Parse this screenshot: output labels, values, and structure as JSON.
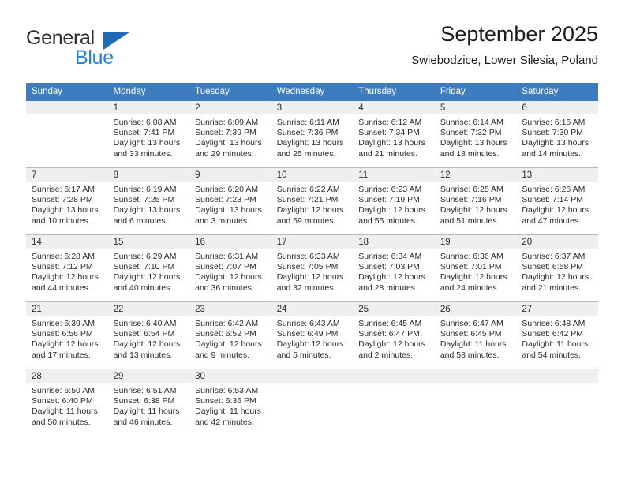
{
  "brand": {
    "name_top": "General",
    "name_bottom": "Blue",
    "accent_dark": "#1f6bb5",
    "accent_light": "#2383d4"
  },
  "header": {
    "title": "September 2025",
    "subtitle": "Swiebodzice, Lower Silesia, Poland"
  },
  "theme": {
    "header_row_bg": "#3d7dbf",
    "daynum_band_bg": "#efefef",
    "grid_line": "#b9b9b9",
    "last_week_line": "#1f5fa8"
  },
  "calendar": {
    "weekday_headers": [
      "Sunday",
      "Monday",
      "Tuesday",
      "Wednesday",
      "Thursday",
      "Friday",
      "Saturday"
    ],
    "weeks": [
      [
        {
          "day": "",
          "empty": true
        },
        {
          "day": "1",
          "sunrise": "Sunrise: 6:08 AM",
          "sunset": "Sunset: 7:41 PM",
          "daylight_1": "Daylight: 13 hours",
          "daylight_2": "and 33 minutes."
        },
        {
          "day": "2",
          "sunrise": "Sunrise: 6:09 AM",
          "sunset": "Sunset: 7:39 PM",
          "daylight_1": "Daylight: 13 hours",
          "daylight_2": "and 29 minutes."
        },
        {
          "day": "3",
          "sunrise": "Sunrise: 6:11 AM",
          "sunset": "Sunset: 7:36 PM",
          "daylight_1": "Daylight: 13 hours",
          "daylight_2": "and 25 minutes."
        },
        {
          "day": "4",
          "sunrise": "Sunrise: 6:12 AM",
          "sunset": "Sunset: 7:34 PM",
          "daylight_1": "Daylight: 13 hours",
          "daylight_2": "and 21 minutes."
        },
        {
          "day": "5",
          "sunrise": "Sunrise: 6:14 AM",
          "sunset": "Sunset: 7:32 PM",
          "daylight_1": "Daylight: 13 hours",
          "daylight_2": "and 18 minutes."
        },
        {
          "day": "6",
          "sunrise": "Sunrise: 6:16 AM",
          "sunset": "Sunset: 7:30 PM",
          "daylight_1": "Daylight: 13 hours",
          "daylight_2": "and 14 minutes."
        }
      ],
      [
        {
          "day": "7",
          "sunrise": "Sunrise: 6:17 AM",
          "sunset": "Sunset: 7:28 PM",
          "daylight_1": "Daylight: 13 hours",
          "daylight_2": "and 10 minutes."
        },
        {
          "day": "8",
          "sunrise": "Sunrise: 6:19 AM",
          "sunset": "Sunset: 7:25 PM",
          "daylight_1": "Daylight: 13 hours",
          "daylight_2": "and 6 minutes."
        },
        {
          "day": "9",
          "sunrise": "Sunrise: 6:20 AM",
          "sunset": "Sunset: 7:23 PM",
          "daylight_1": "Daylight: 13 hours",
          "daylight_2": "and 3 minutes."
        },
        {
          "day": "10",
          "sunrise": "Sunrise: 6:22 AM",
          "sunset": "Sunset: 7:21 PM",
          "daylight_1": "Daylight: 12 hours",
          "daylight_2": "and 59 minutes."
        },
        {
          "day": "11",
          "sunrise": "Sunrise: 6:23 AM",
          "sunset": "Sunset: 7:19 PM",
          "daylight_1": "Daylight: 12 hours",
          "daylight_2": "and 55 minutes."
        },
        {
          "day": "12",
          "sunrise": "Sunrise: 6:25 AM",
          "sunset": "Sunset: 7:16 PM",
          "daylight_1": "Daylight: 12 hours",
          "daylight_2": "and 51 minutes."
        },
        {
          "day": "13",
          "sunrise": "Sunrise: 6:26 AM",
          "sunset": "Sunset: 7:14 PM",
          "daylight_1": "Daylight: 12 hours",
          "daylight_2": "and 47 minutes."
        }
      ],
      [
        {
          "day": "14",
          "sunrise": "Sunrise: 6:28 AM",
          "sunset": "Sunset: 7:12 PM",
          "daylight_1": "Daylight: 12 hours",
          "daylight_2": "and 44 minutes."
        },
        {
          "day": "15",
          "sunrise": "Sunrise: 6:29 AM",
          "sunset": "Sunset: 7:10 PM",
          "daylight_1": "Daylight: 12 hours",
          "daylight_2": "and 40 minutes."
        },
        {
          "day": "16",
          "sunrise": "Sunrise: 6:31 AM",
          "sunset": "Sunset: 7:07 PM",
          "daylight_1": "Daylight: 12 hours",
          "daylight_2": "and 36 minutes."
        },
        {
          "day": "17",
          "sunrise": "Sunrise: 6:33 AM",
          "sunset": "Sunset: 7:05 PM",
          "daylight_1": "Daylight: 12 hours",
          "daylight_2": "and 32 minutes."
        },
        {
          "day": "18",
          "sunrise": "Sunrise: 6:34 AM",
          "sunset": "Sunset: 7:03 PM",
          "daylight_1": "Daylight: 12 hours",
          "daylight_2": "and 28 minutes."
        },
        {
          "day": "19",
          "sunrise": "Sunrise: 6:36 AM",
          "sunset": "Sunset: 7:01 PM",
          "daylight_1": "Daylight: 12 hours",
          "daylight_2": "and 24 minutes."
        },
        {
          "day": "20",
          "sunrise": "Sunrise: 6:37 AM",
          "sunset": "Sunset: 6:58 PM",
          "daylight_1": "Daylight: 12 hours",
          "daylight_2": "and 21 minutes."
        }
      ],
      [
        {
          "day": "21",
          "sunrise": "Sunrise: 6:39 AM",
          "sunset": "Sunset: 6:56 PM",
          "daylight_1": "Daylight: 12 hours",
          "daylight_2": "and 17 minutes."
        },
        {
          "day": "22",
          "sunrise": "Sunrise: 6:40 AM",
          "sunset": "Sunset: 6:54 PM",
          "daylight_1": "Daylight: 12 hours",
          "daylight_2": "and 13 minutes."
        },
        {
          "day": "23",
          "sunrise": "Sunrise: 6:42 AM",
          "sunset": "Sunset: 6:52 PM",
          "daylight_1": "Daylight: 12 hours",
          "daylight_2": "and 9 minutes."
        },
        {
          "day": "24",
          "sunrise": "Sunrise: 6:43 AM",
          "sunset": "Sunset: 6:49 PM",
          "daylight_1": "Daylight: 12 hours",
          "daylight_2": "and 5 minutes."
        },
        {
          "day": "25",
          "sunrise": "Sunrise: 6:45 AM",
          "sunset": "Sunset: 6:47 PM",
          "daylight_1": "Daylight: 12 hours",
          "daylight_2": "and 2 minutes."
        },
        {
          "day": "26",
          "sunrise": "Sunrise: 6:47 AM",
          "sunset": "Sunset: 6:45 PM",
          "daylight_1": "Daylight: 11 hours",
          "daylight_2": "and 58 minutes."
        },
        {
          "day": "27",
          "sunrise": "Sunrise: 6:48 AM",
          "sunset": "Sunset: 6:42 PM",
          "daylight_1": "Daylight: 11 hours",
          "daylight_2": "and 54 minutes."
        }
      ],
      [
        {
          "day": "28",
          "sunrise": "Sunrise: 6:50 AM",
          "sunset": "Sunset: 6:40 PM",
          "daylight_1": "Daylight: 11 hours",
          "daylight_2": "and 50 minutes."
        },
        {
          "day": "29",
          "sunrise": "Sunrise: 6:51 AM",
          "sunset": "Sunset: 6:38 PM",
          "daylight_1": "Daylight: 11 hours",
          "daylight_2": "and 46 minutes."
        },
        {
          "day": "30",
          "sunrise": "Sunrise: 6:53 AM",
          "sunset": "Sunset: 6:36 PM",
          "daylight_1": "Daylight: 11 hours",
          "daylight_2": "and 42 minutes."
        },
        {
          "day": "",
          "empty": true
        },
        {
          "day": "",
          "empty": true
        },
        {
          "day": "",
          "empty": true
        },
        {
          "day": "",
          "empty": true
        }
      ]
    ]
  }
}
